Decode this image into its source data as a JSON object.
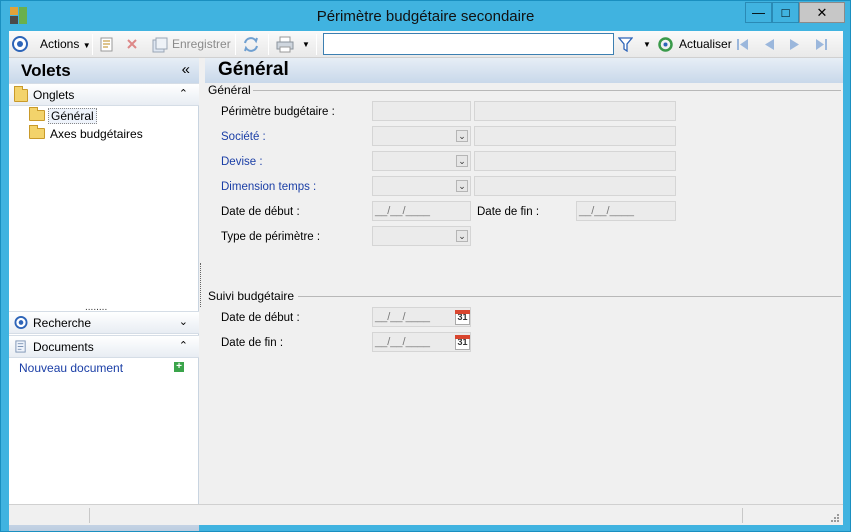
{
  "window": {
    "title": "Périmètre budgétaire secondaire",
    "min_label": "—",
    "max_label": "□",
    "close_label": "✕"
  },
  "toolbar": {
    "actions_label": "Actions",
    "save_label": "Enregistrer",
    "search_value": "",
    "refresh_label": "Actualiser"
  },
  "left_panel": {
    "title": "Volets",
    "collapse_glyph": "«",
    "tabs_section": "Onglets",
    "tree": [
      {
        "label": "Général"
      },
      {
        "label": "Axes budgétaires"
      }
    ],
    "resize_handle": "........",
    "search_section": "Recherche",
    "documents_section": "Documents",
    "new_document": "Nouveau document",
    "plus_glyph": "+",
    "up_glyph": "⌃",
    "down_glyph": "⌄",
    "bottom_glyph": "▾"
  },
  "main": {
    "title": "Général",
    "general_group": "Général",
    "fields": {
      "perimetre_label": "Périmètre budgétaire :",
      "societe_label": "Société :",
      "devise_label": "Devise :",
      "dimension_label": "Dimension temps :",
      "date_debut_label": "Date de début :",
      "date_fin_label": "Date de fin :",
      "type_label": "Type de périmètre :",
      "date_placeholder": "__/__/____"
    },
    "suivi_group": "Suivi budgétaire",
    "suivi": {
      "date_debut_label": "Date de début :",
      "date_fin_label": "Date de fin :",
      "calendar_day": "31"
    }
  },
  "icons": {
    "dropdown": "⌄",
    "double_dropdown": "⌄"
  }
}
